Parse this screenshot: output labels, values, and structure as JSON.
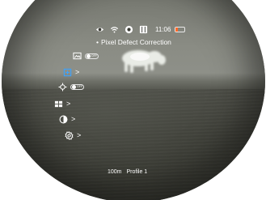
{
  "status_bar": {
    "icons": [
      "eye-icon",
      "wifi-icon",
      "record-icon",
      "film-icon"
    ],
    "time": "11:06",
    "battery_level_percent": 20,
    "battery_color": "#ff6a2a"
  },
  "title": {
    "bullet": "•",
    "text": "Pixel Defect Correction"
  },
  "menu": [
    {
      "icon": "image-display-icon",
      "toggle": true,
      "toggle_label": "OFF"
    },
    {
      "icon": "add-square-icon",
      "chevron": ">",
      "highlighted": true,
      "accent": "#3aa3ff"
    },
    {
      "icon": "crosshair-icon",
      "toggle": true,
      "toggle_label": "OFF"
    },
    {
      "icon": "windows-grid-icon",
      "chevron": ">"
    },
    {
      "icon": "palette-icon",
      "chevron": ">"
    },
    {
      "icon": "gear-icon",
      "chevron": ">"
    }
  ],
  "bottom": {
    "distance": "100m",
    "profile": "Profile 1"
  }
}
